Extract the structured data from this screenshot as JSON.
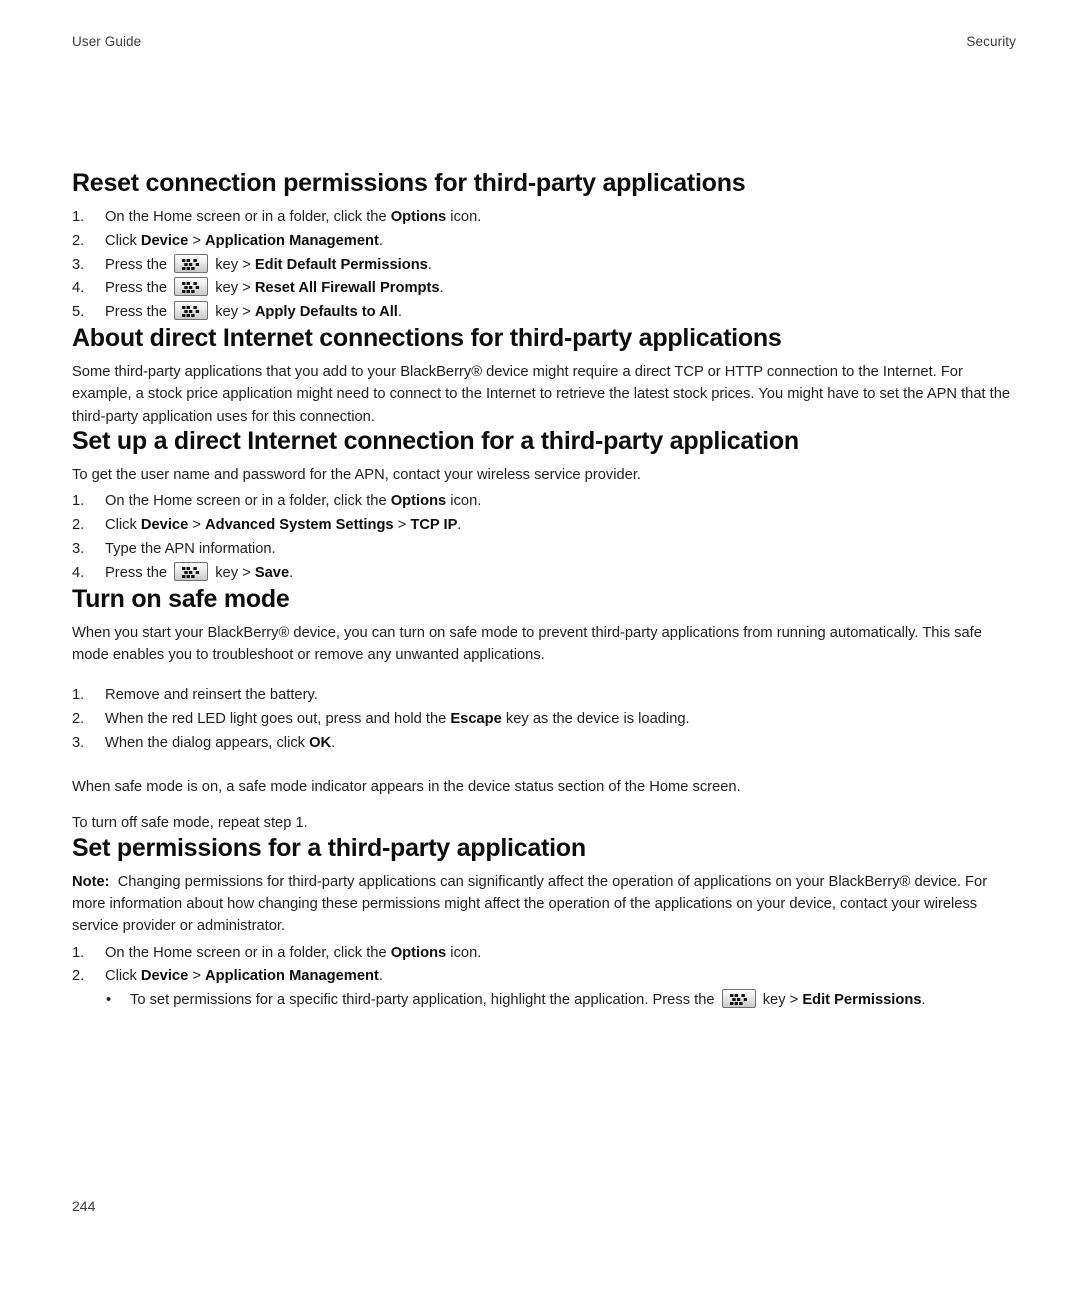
{
  "header": {
    "left": "User Guide",
    "right": "Security"
  },
  "footer": {
    "page_number": "244"
  },
  "icons": {
    "menu_key": "blackberry-menu-key-icon"
  },
  "sections": [
    {
      "id": "reset-connection-permissions",
      "heading": "Reset connection permissions for third-party applications",
      "steps": [
        {
          "num": "1.",
          "parts": [
            {
              "t": "On the Home screen or in a folder, click the ",
              "bold": false
            },
            {
              "t": "Options",
              "bold": true
            },
            {
              "t": " icon.",
              "bold": false
            }
          ]
        },
        {
          "num": "2.",
          "parts": [
            {
              "t": "Click ",
              "bold": false
            },
            {
              "t": "Device",
              "bold": true
            },
            {
              "t": " > ",
              "bold": false
            },
            {
              "t": "Application Management",
              "bold": true
            },
            {
              "t": ".",
              "bold": false
            }
          ]
        },
        {
          "num": "3.",
          "key": true,
          "pre": "Press the ",
          "parts": [
            {
              "t": " key > ",
              "bold": false
            },
            {
              "t": "Edit Default Permissions",
              "bold": true
            },
            {
              "t": ".",
              "bold": false
            }
          ]
        },
        {
          "num": "4.",
          "key": true,
          "pre": "Press the ",
          "parts": [
            {
              "t": " key > ",
              "bold": false
            },
            {
              "t": "Reset All Firewall Prompts",
              "bold": true
            },
            {
              "t": ".",
              "bold": false
            }
          ]
        },
        {
          "num": "5.",
          "key": true,
          "pre": "Press the ",
          "parts": [
            {
              "t": " key > ",
              "bold": false
            },
            {
              "t": "Apply Defaults to All",
              "bold": true
            },
            {
              "t": ".",
              "bold": false
            }
          ]
        }
      ]
    },
    {
      "id": "about-direct-internet-connections",
      "heading": "About direct Internet connections for third-party applications",
      "paragraph": "Some third-party applications that you add to your BlackBerry® device might require a direct TCP or HTTP connection to the Internet. For example, a stock price application might need to connect to the Internet to retrieve the latest stock prices. You might have to set the APN that the third-party application uses for this connection."
    },
    {
      "id": "set-up-direct-internet-connection",
      "heading": "Set up a direct Internet connection for a third-party application",
      "intro": "To get the user name and password for the APN, contact your wireless service provider.",
      "steps": [
        {
          "num": "1.",
          "parts": [
            {
              "t": "On the Home screen or in a folder, click the ",
              "bold": false
            },
            {
              "t": "Options",
              "bold": true
            },
            {
              "t": " icon.",
              "bold": false
            }
          ]
        },
        {
          "num": "2.",
          "parts": [
            {
              "t": "Click ",
              "bold": false
            },
            {
              "t": "Device",
              "bold": true
            },
            {
              "t": " > ",
              "bold": false
            },
            {
              "t": "Advanced System Settings",
              "bold": true
            },
            {
              "t": " > ",
              "bold": false
            },
            {
              "t": "TCP IP",
              "bold": true
            },
            {
              "t": ".",
              "bold": false
            }
          ]
        },
        {
          "num": "3.",
          "parts": [
            {
              "t": "Type the APN information.",
              "bold": false
            }
          ]
        },
        {
          "num": "4.",
          "key": true,
          "pre": "Press the ",
          "parts": [
            {
              "t": " key > ",
              "bold": false
            },
            {
              "t": "Save",
              "bold": true
            },
            {
              "t": ".",
              "bold": false
            }
          ]
        }
      ]
    },
    {
      "id": "turn-on-safe-mode",
      "heading": "Turn on safe mode",
      "paragraph": "When you start your BlackBerry® device, you can turn on safe mode to prevent third-party applications from running automatically. This safe mode enables you to troubleshoot or remove any unwanted applications.",
      "steps": [
        {
          "num": "1.",
          "parts": [
            {
              "t": "Remove and reinsert the battery.",
              "bold": false
            }
          ]
        },
        {
          "num": "2.",
          "parts": [
            {
              "t": "When the red LED light goes out, press and hold the ",
              "bold": false
            },
            {
              "t": "Escape",
              "bold": true
            },
            {
              "t": " key as the device is loading.",
              "bold": false
            }
          ]
        },
        {
          "num": "3.",
          "parts": [
            {
              "t": "When the dialog appears, click ",
              "bold": false
            },
            {
              "t": "OK",
              "bold": true
            },
            {
              "t": ".",
              "bold": false
            }
          ]
        }
      ],
      "after_paragraphs": [
        "When safe mode is on, a safe mode indicator appears in the device status section of the Home screen.",
        "To turn off safe mode, repeat step 1."
      ]
    },
    {
      "id": "set-permissions-third-party",
      "heading": "Set permissions for a third-party application",
      "note_label": "Note:",
      "note_text": "Changing permissions for third-party applications can significantly affect the operation of applications on your BlackBerry® device. For more information about how changing these permissions might affect the operation of the applications on your device, contact your wireless service provider or administrator.",
      "steps": [
        {
          "num": "1.",
          "parts": [
            {
              "t": "On the Home screen or in a folder, click the ",
              "bold": false
            },
            {
              "t": "Options",
              "bold": true
            },
            {
              "t": " icon.",
              "bold": false
            }
          ]
        },
        {
          "num": "2.",
          "parts": [
            {
              "t": "Click ",
              "bold": false
            },
            {
              "t": "Device",
              "bold": true
            },
            {
              "t": " > ",
              "bold": false
            },
            {
              "t": "Application Management",
              "bold": true
            },
            {
              "t": ".",
              "bold": false
            }
          ]
        }
      ],
      "bullets": [
        {
          "marker": "•",
          "key": true,
          "pre": "To set permissions for a specific third-party application, highlight the application. Press the ",
          "parts": [
            {
              "t": " key > ",
              "bold": false
            },
            {
              "t": "Edit Permissions",
              "bold": true
            },
            {
              "t": ".",
              "bold": false
            }
          ]
        }
      ]
    }
  ]
}
